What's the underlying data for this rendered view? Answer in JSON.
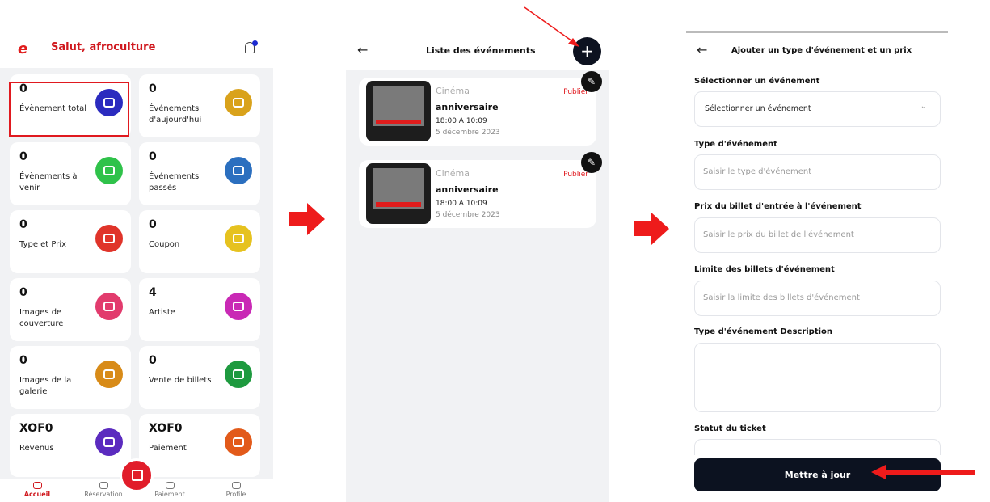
{
  "dashboard": {
    "greeting": "Salut, afroculture",
    "logo_glyph": "e",
    "cards": [
      {
        "value": "0",
        "label": "Évènement total",
        "icon": "ticket-icon",
        "color": "#2b2bbf"
      },
      {
        "value": "0",
        "label": "Événements d'aujourd'hui",
        "icon": "calendar-icon",
        "color": "#d9a21b"
      },
      {
        "value": "0",
        "label": "Évènements à venir",
        "icon": "calendar-clock-icon",
        "color": "#2fc24a"
      },
      {
        "value": "0",
        "label": "Événements passés",
        "icon": "calendar-check-icon",
        "color": "#2b6fbf"
      },
      {
        "value": "0",
        "label": "Type et Prix",
        "icon": "list-icon",
        "color": "#e0342a"
      },
      {
        "value": "0",
        "label": "Coupon",
        "icon": "coupon-icon",
        "color": "#e6c21f"
      },
      {
        "value": "0",
        "label": "Images de couverture",
        "icon": "image-icon",
        "color": "#e23b6d"
      },
      {
        "value": "4",
        "label": "Artiste",
        "icon": "artist-icon",
        "color": "#c929b5"
      },
      {
        "value": "0",
        "label": "Images de la galerie",
        "icon": "gallery-icon",
        "color": "#d88b18"
      },
      {
        "value": "0",
        "label": "Vente de billets",
        "icon": "ticket-sales-icon",
        "color": "#1e9a3f"
      },
      {
        "value": "XOF0",
        "label": "Revenus",
        "icon": "revenue-icon",
        "color": "#5b2bbf"
      },
      {
        "value": "XOF0",
        "label": "Paiement",
        "icon": "payment-icon",
        "color": "#e25a1a"
      }
    ],
    "nav": [
      {
        "label": "Accueil",
        "icon": "home-icon",
        "active": true
      },
      {
        "label": "Réservation",
        "icon": "calendar-icon",
        "active": false
      },
      {
        "label": "Paiement",
        "icon": "wallet-icon",
        "active": false
      },
      {
        "label": "Profile",
        "icon": "user-icon",
        "active": false
      }
    ]
  },
  "events_list": {
    "title": "Liste des événements",
    "back_glyph": "←",
    "add_glyph": "+",
    "edit_glyph": "✎",
    "events": [
      {
        "category": "Cinéma",
        "name": "anniversaire",
        "time": "18:00 A 10:09",
        "date": "5 décembre 2023",
        "status": "Publier"
      },
      {
        "category": "Cinéma",
        "name": "anniversaire",
        "time": "18:00 A 10:09",
        "date": "5 décembre 2023",
        "status": "Publier"
      }
    ]
  },
  "form": {
    "title": "Ajouter un type d'événement et un prix",
    "back_glyph": "←",
    "event_label": "Sélectionner un événement",
    "event_value": "Sélectionner un événement",
    "chevron": "⌄",
    "type_label": "Type d'événement",
    "type_placeholder": "Saisir le type d'événement",
    "price_label": "Prix du billet d'entrée à l'événement",
    "price_placeholder": "Saisir le prix du billet de l'événement",
    "limit_label": "Limite des billets d'événement",
    "limit_placeholder": "Saisir la limite des billets d'événement",
    "desc_label": "Type d'événement Description",
    "status_label": "Statut du ticket",
    "submit_label": "Mettre à jour"
  },
  "annotation_color": "#ee1b1b"
}
